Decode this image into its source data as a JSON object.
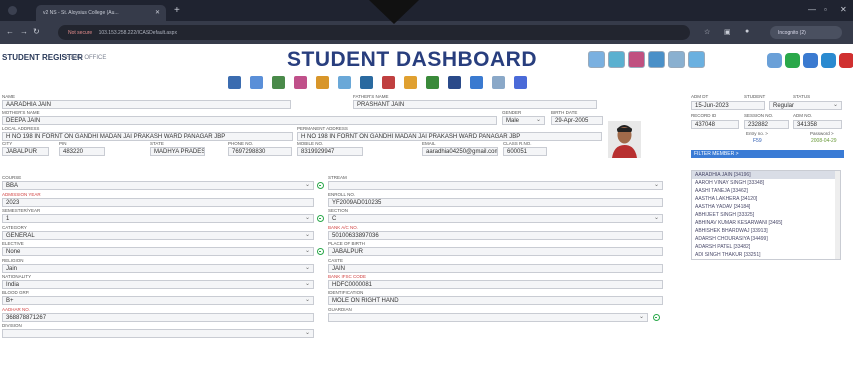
{
  "browser": {
    "tab_title": "v2 NS - St. Aloysius College (Au...",
    "url_warning": "Not secure",
    "url": "103.153.258.222/ICASDefault.aspx",
    "incognito_label": "Incognito (2)"
  },
  "header": {
    "register_title": "STUDENT REGISTER",
    "office": "HEAD OFFICE",
    "dashboard_title": "STUDENT DASHBOARD"
  },
  "icons": {
    "toolbar": [
      "student-icon",
      "calendar-icon",
      "group-icon",
      "folder-icon",
      "pen-icon",
      "book-icon",
      "bus-icon",
      "document-icon",
      "bag-icon",
      "money-icon",
      "report-icon",
      "upload-icon",
      "certificate-icon",
      "settings-icon"
    ],
    "toolbar_colors": [
      "#3b6cb0",
      "#5a8fd8",
      "#4a8a4a",
      "#c0508a",
      "#d8962a",
      "#6aa8d8",
      "#2a6aa0",
      "#c04040",
      "#e0a030",
      "#3a8a3a",
      "#2a4a8a",
      "#3a7ad0",
      "#8aa8c8",
      "#4a6ad8"
    ],
    "top_colors": [
      "#7ab0e0",
      "#5ab0d0",
      "#c05080",
      "#4a90c8",
      "#8ab0d0",
      "#6ab0e0"
    ],
    "top2_colors": [
      "#6aa0d8",
      "#2aa84a",
      "#3a7ad0",
      "#2a8ad0",
      "#d03030"
    ]
  },
  "form": {
    "name_label": "NAME",
    "name": "AARADHIA JAIN",
    "fathers_name_label": "FATHER'S NAME",
    "fathers_name": "PRASHANT JAIN",
    "mothers_name_label": "MOTHER'S NAME",
    "mothers_name": "DEEPA JAIN",
    "gender_label": "GENDER",
    "gender": "Male",
    "birth_date_label": "BIRTH DATE",
    "birth_date": "29-Apr-2005",
    "local_address_label": "LOCAL ADDRESS",
    "local_address": "H NO 198 IN FORNT ON GANDHI MADAN JAI PRAKASH WARD PANAGAR JBP",
    "permanent_address_label": "PERMANENT ADDRESS",
    "permanent_address": "H NO 198 IN FORNT ON GANDHI MADAN JAI PRAKASH WARD PANAGAR JBP",
    "city_label": "CITY",
    "city": "JABALPUR",
    "pin_label": "PIN",
    "pin": "483220",
    "state_label": "STATE",
    "state": "MADHYA PRADESH",
    "phone_label": "PHONE NO.",
    "phone": "7697298830",
    "mobile_label": "MOBILE NO.",
    "mobile": "8319929947",
    "email_label": "EMAIL",
    "email": "aaradhia04250@gmail.com",
    "class_roll_label": "CLASS R.NO.",
    "class_roll": "600051",
    "course_label": "COURSE",
    "course": "BBA",
    "stream_label": "STREAM",
    "stream": "",
    "admission_year_label": "ADMISSION YEAR",
    "admission_year": "2023",
    "enroll_label": "ENROLL NO.",
    "enroll": "YF2009AD010235",
    "semester_label": "SEMESTER/YEAR",
    "semester": "1",
    "section_label": "SECTION",
    "section": "C",
    "category_label": "CATEGORY",
    "category": "GENERAL",
    "bank_ac_label": "BANK A/C NO.",
    "bank_ac": "50100633897036",
    "elective_label": "ELECTIVE",
    "elective": "None",
    "birth_place_label": "PLACE OF BIRTH",
    "birth_place": "JABALPUR",
    "religion_label": "RELIGION",
    "religion": "Jain",
    "caste_label": "CASTE",
    "caste": "JAIN",
    "nationality_label": "NATIONALITY",
    "nationality": "India",
    "ifsc_label": "BANK IFSC CODE",
    "ifsc": "HDFC0000081",
    "blood_group_label": "BLOOD GRP.",
    "blood_group": "B+",
    "identification_label": "IDENTIFICATION",
    "identification": "MOLE ON RIGHT HAND",
    "aadhar_label": "AADHAR NO.",
    "aadhar": "368878871267",
    "guardian_label": "GUARDIAN",
    "guardian": "",
    "division_label": "DIVISION",
    "division": ""
  },
  "side": {
    "adm_dt_label": "ADM DT",
    "adm_dt": "15-Jun-2023",
    "student_label": "STUDENT",
    "status_label": "STATUS",
    "status": "Regular",
    "record_id_label": "RECORD ID",
    "record_id": "437048",
    "session_label": "SESSION NO.",
    "session_no": "232882",
    "adm_no_label": "ADM NO.",
    "adm_no": "341358",
    "entry_label": "Entry no. >",
    "entry_val": "F59",
    "password_label": "Password >",
    "password_val": "2008-04-29",
    "filter_label": "FILTER MEMBER >",
    "members": [
      "AARADHIA JAIN [34196]",
      "AAROH VINAY SINGH [33348]",
      "AASHI TANEJA [33462]",
      "AASTHA LAKHERA [34120]",
      "AASTHA YADAV [34184]",
      "ABHIJEET SINGH [33325]",
      "ABHINAV KUMAR KESARWANI [3465]",
      "ABHISHEK BHARDWAJ [33913]",
      "ADARSH CHOURASIYA [34499]",
      "ADARSH PATEL [33482]",
      "ADI SINGH THAKUR [33251]"
    ]
  }
}
